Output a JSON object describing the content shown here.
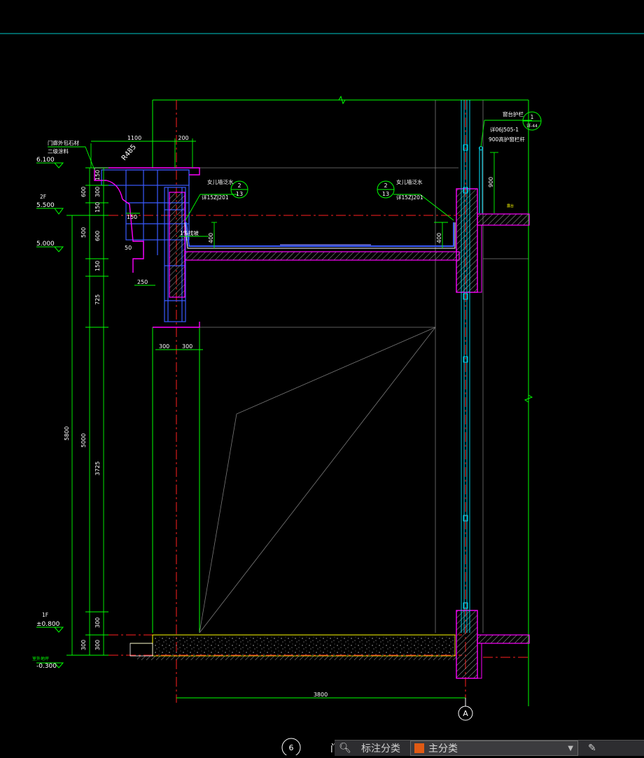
{
  "window": {
    "title": ""
  },
  "colors": {
    "background": "#000000",
    "cyan": "#00e5ff",
    "green": "#00ff00",
    "magenta": "#ff00ff",
    "red": "#ff2020",
    "blue": "#3a5bff",
    "yellow": "#ffff00",
    "white": "#ffffff",
    "hatch": "#a0a0a0"
  },
  "drawing": {
    "level_labels": {
      "l6100": "6.100",
      "l2f": "2F",
      "l5500": "5.500",
      "l5000": "5.000",
      "l1f": "1F",
      "l0800": "±0.800",
      "lm0300": "-0.300"
    },
    "dims": {
      "d1100": "1100",
      "d200": "200",
      "r485": "R485",
      "d600a": "600",
      "d300a": "300",
      "d150a": "150",
      "d150b": "150",
      "d150c": "150",
      "d500": "500",
      "d600b": "600",
      "d50": "50",
      "d150d": "150",
      "d250": "250",
      "d725": "725",
      "d300b": "300",
      "d300c": "300",
      "d5800": "5800",
      "d5000": "5000",
      "d3725": "3725",
      "d300d": "300",
      "d300e": "300",
      "d300f": "300",
      "d3800": "3800",
      "d400a": "400",
      "d400b": "400",
      "d900": "900"
    },
    "annotations": {
      "door_head": "门廊外包石材",
      "paint": "二级涂料",
      "parapet_left": "女儿墙泛水",
      "parapet_ref_left": "详15ZJ201",
      "parapet_right": "女儿墙泛水",
      "parapet_ref_right": "详15ZJ201",
      "slope": "1%找坡",
      "railing": "窗台护栏",
      "railing_ref": "详06J505-1",
      "railing_height": "900高护窗栏杆",
      "small_note": "露台",
      "bottom_level": "室外地坪"
    },
    "bubbles": {
      "b_left_top": "2",
      "b_left_bot": "13",
      "b_right_top": "2",
      "b_right_bot": "13",
      "b_rail_top": "1",
      "b_rail_bot": "详-44",
      "axis_a": "A",
      "section_no": "6",
      "section_title": "门"
    }
  },
  "status_panel": {
    "tool_icon": "binoculars-icon",
    "label": "标注分类",
    "layer": "主分类",
    "layer_color": "#e05a14",
    "edit_icon": "pencil-icon"
  }
}
